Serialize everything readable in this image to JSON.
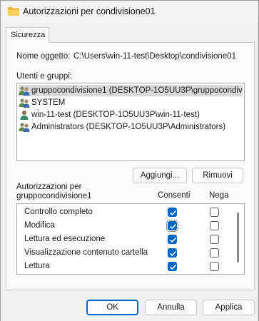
{
  "window": {
    "title": "Autorizzazioni per condivisione01",
    "icon": "folder-icon"
  },
  "tabs": [
    {
      "label": "Sicurezza",
      "active": true
    }
  ],
  "object": {
    "label": "Nome oggetto:",
    "value": "C:\\Users\\win-11-test\\Desktop\\condivisione01"
  },
  "users": {
    "label": "Utenti e gruppi:",
    "items": [
      {
        "label": "gruppocondivisione1 (DESKTOP-1O5UU3P\\gruppocondivi...",
        "icon": "group-icon",
        "selected": true
      },
      {
        "label": "SYSTEM",
        "icon": "group-icon",
        "selected": false
      },
      {
        "label": "win-11-test (DESKTOP-1O5UU3P\\win-11-test)",
        "icon": "user-icon",
        "selected": false
      },
      {
        "label": "Administrators (DESKTOP-1O5UU3P\\Administrators)",
        "icon": "group-icon",
        "selected": false
      }
    ],
    "add_label": "Aggiungi...",
    "remove_label": "Rimuovi"
  },
  "permissions": {
    "label_line1": "Autorizzazioni per",
    "label_line2": "gruppocondivisione1",
    "allow_header": "Consenti",
    "deny_header": "Nega",
    "items": [
      {
        "label": "Controllo completo",
        "allow": true,
        "deny": false
      },
      {
        "label": "Modifica",
        "allow": true,
        "deny": false
      },
      {
        "label": "Lettura ed esecuzione",
        "allow": true,
        "deny": false
      },
      {
        "label": "Visualizzazione contenuto cartella",
        "allow": true,
        "deny": false
      },
      {
        "label": "Lettura",
        "allow": true,
        "deny": false
      },
      {
        "label": "",
        "allow": true,
        "deny": false
      }
    ]
  },
  "buttons": {
    "ok": "OK",
    "cancel": "Annulla",
    "apply": "Applica"
  },
  "colors": {
    "accent": "#0067c0",
    "selection": "#d9d9d9"
  }
}
